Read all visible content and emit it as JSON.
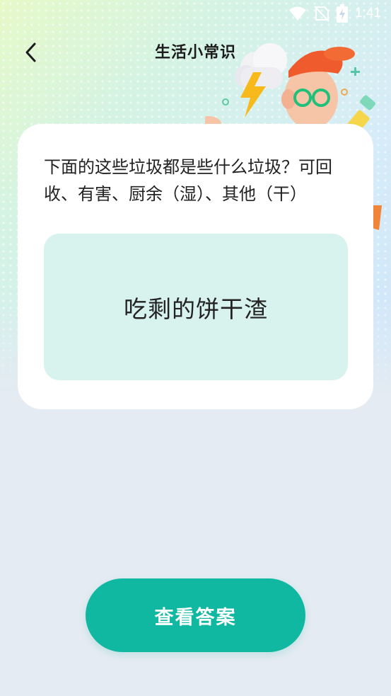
{
  "status_bar": {
    "time": "1:41",
    "icons": [
      "wifi-icon",
      "no-sim-icon",
      "battery-charging-icon"
    ]
  },
  "header": {
    "title": "生活小常识",
    "back_icon": "chevron-left-icon"
  },
  "question": {
    "text": "下面的这些垃圾都是些什么垃圾？可回收、有害、厨余（湿）、其他（干）",
    "item": "吃剩的饼干渣"
  },
  "actions": {
    "show_answer_label": "查看答案"
  },
  "colors": {
    "accent": "#10b8a1",
    "item_box_bg": "#d8f3ee",
    "page_bg": "#e4ebf2"
  }
}
